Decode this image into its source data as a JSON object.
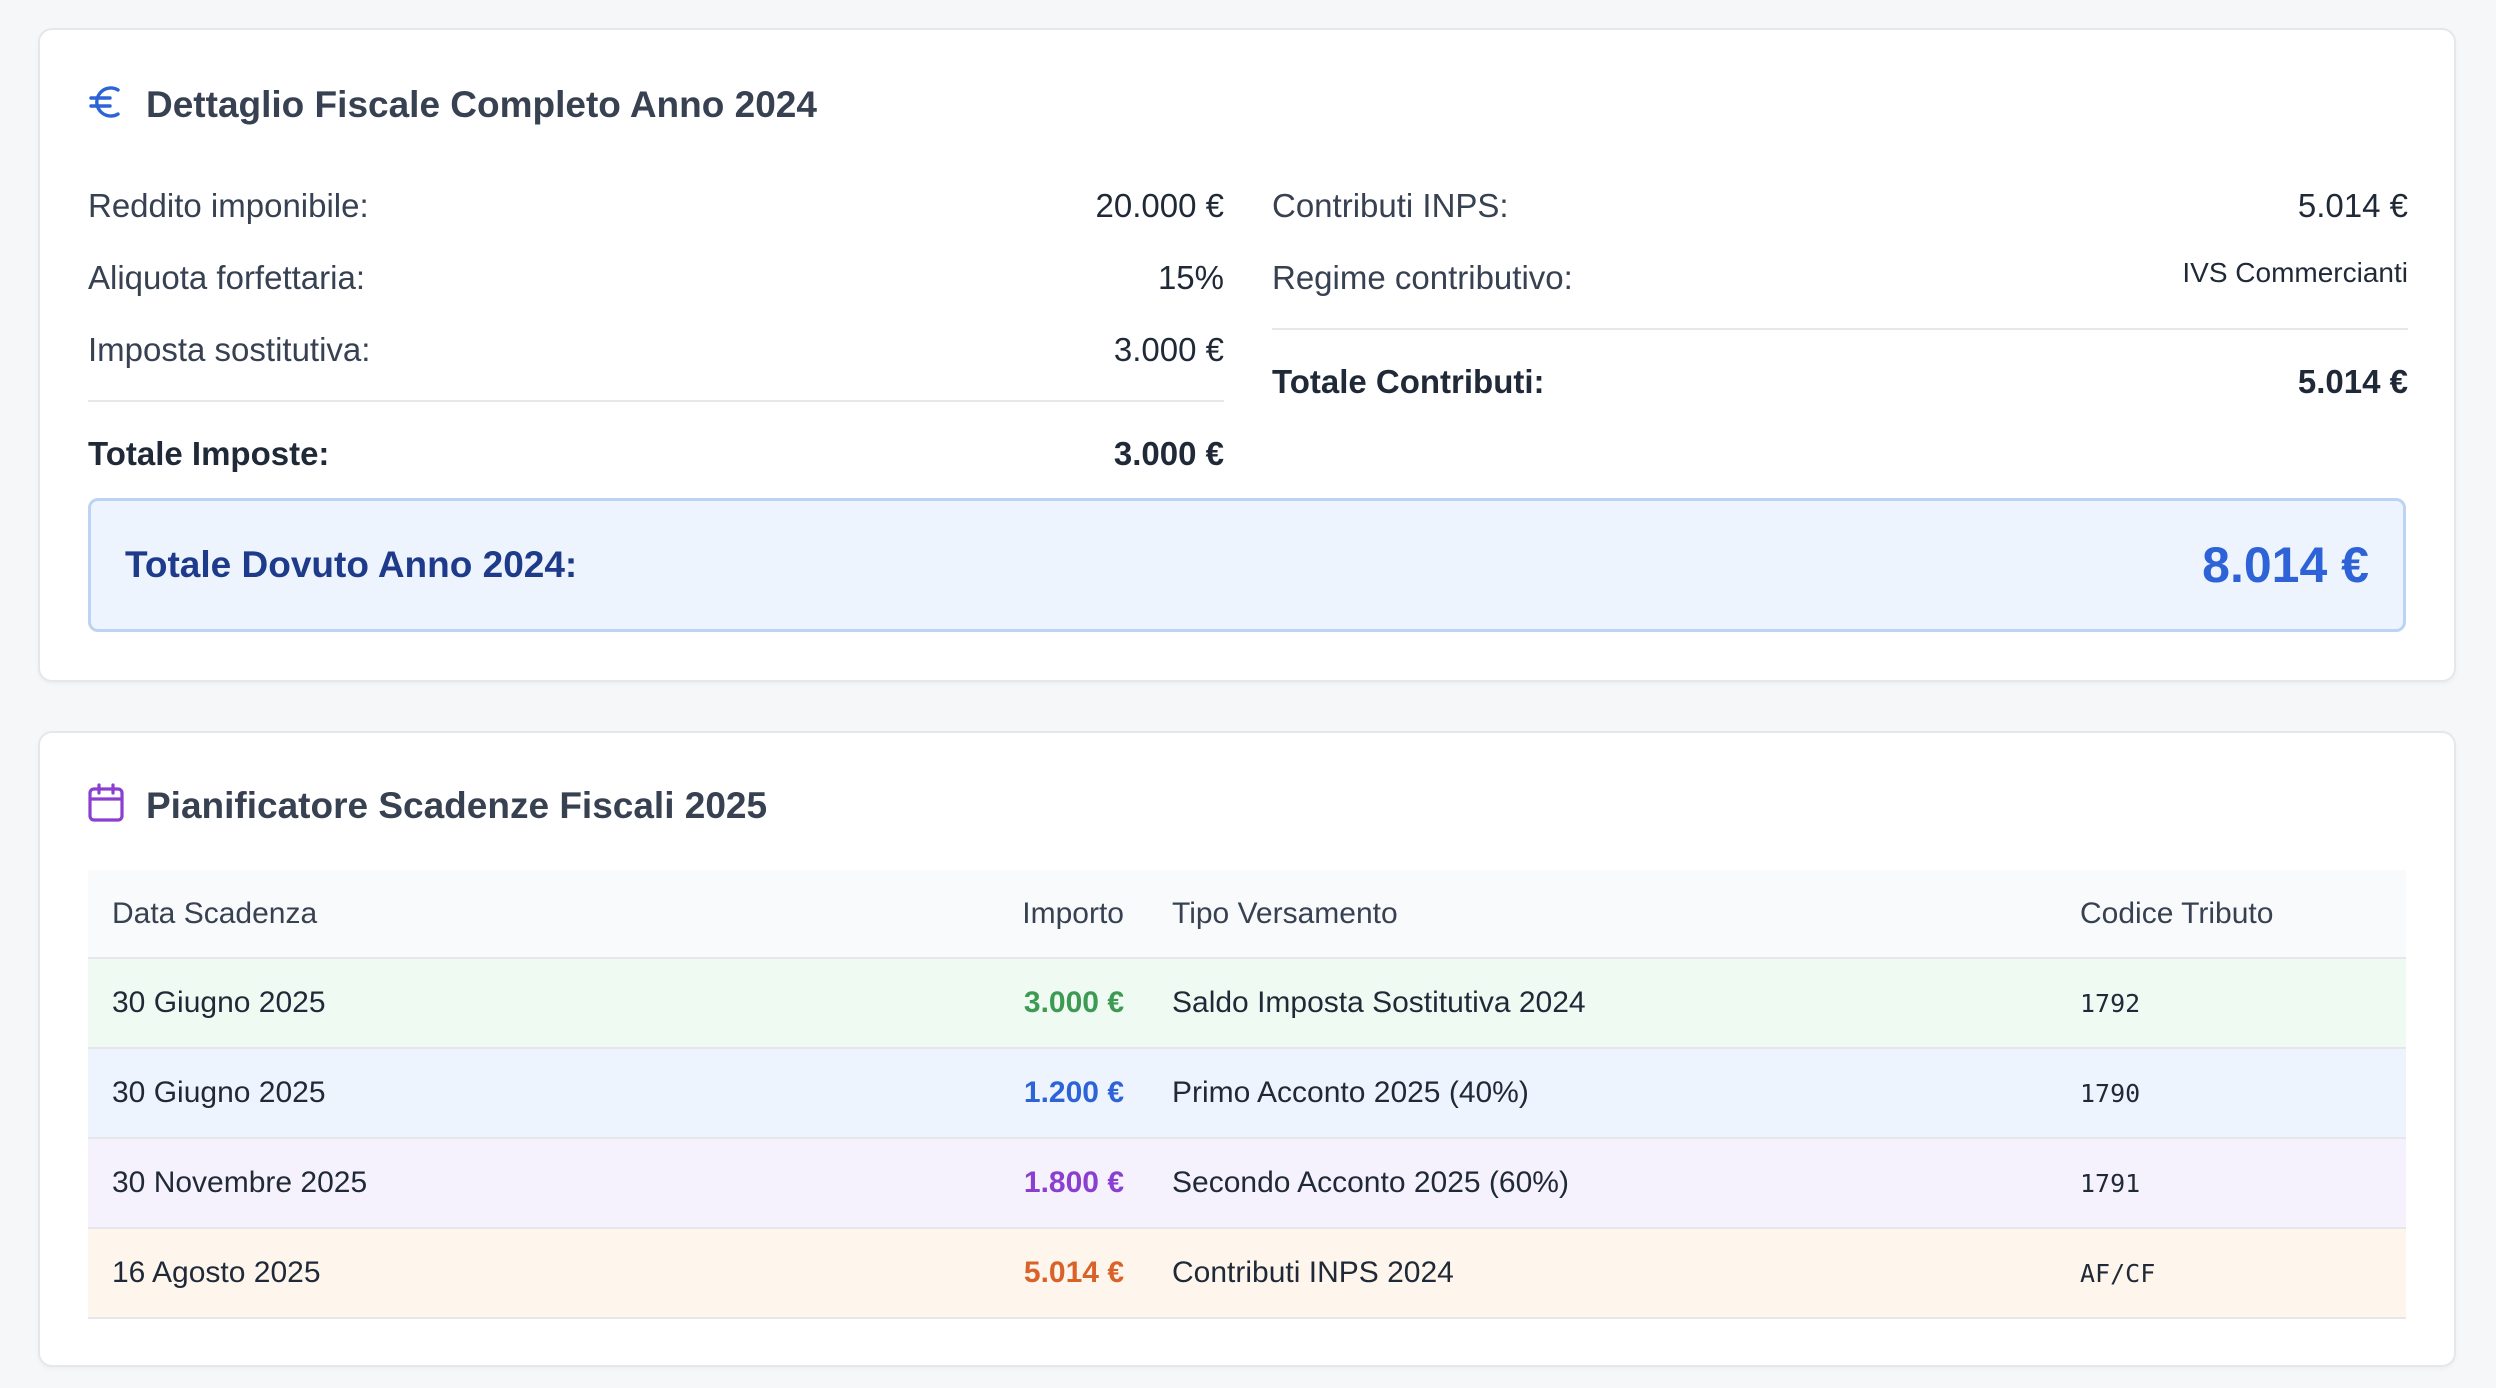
{
  "fiscal": {
    "title": "Dettaglio Fiscale Completo Anno 2024",
    "left": [
      {
        "label": "Reddito imponibile:",
        "value": "20.000 €"
      },
      {
        "label": "Aliquota forfettaria:",
        "value": "15%"
      },
      {
        "label": "Imposta sostitutiva:",
        "value": "3.000 €"
      }
    ],
    "left_total": {
      "label": "Totale Imposte:",
      "value": "3.000 €"
    },
    "right": [
      {
        "label": "Contributi INPS:",
        "value": "5.014 €"
      },
      {
        "label": "Regime contributivo:",
        "value": "IVS Commercianti"
      }
    ],
    "right_total": {
      "label": "Totale Contributi:",
      "value": "5.014 €"
    },
    "grand_total": {
      "label": "Totale Dovuto Anno 2024:",
      "value": "8.014 €"
    }
  },
  "planner": {
    "title": "Pianificatore Scadenze Fiscali 2025",
    "headers": {
      "date": "Data Scadenza",
      "amount": "Importo",
      "type": "Tipo Versamento",
      "code": "Codice Tributo"
    },
    "rows": [
      {
        "date": "30 Giugno 2025",
        "amount": "3.000 €",
        "type": "Saldo Imposta Sostitutiva 2024",
        "code": "1792",
        "color": "#3d9a52"
      },
      {
        "date": "30 Giugno 2025",
        "amount": "1.200 €",
        "type": "Primo Acconto 2025 (40%)",
        "code": "1790",
        "color": "#2d63d6"
      },
      {
        "date": "30 Novembre 2025",
        "amount": "1.800 €",
        "type": "Secondo Acconto 2025 (60%)",
        "code": "1791",
        "color": "#8a3fd1"
      },
      {
        "date": "16 Agosto 2025",
        "amount": "5.014 €",
        "type": "Contributi INPS 2024",
        "code": "AF/CF",
        "color": "#d9622b"
      }
    ]
  },
  "icons": {
    "fiscal": "euro-icon",
    "planner": "calendar-icon"
  },
  "colors": {
    "accent": "#2d63d6",
    "green": "#3d9a52",
    "purple": "#8a3fd1",
    "orange": "#d9622b"
  }
}
